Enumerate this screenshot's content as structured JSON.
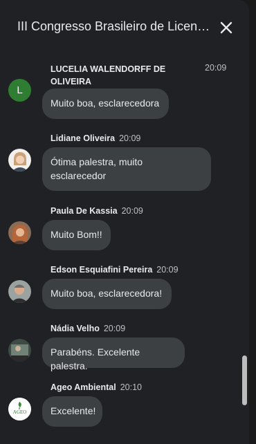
{
  "header": {
    "title": "III Congresso Brasileiro de Licenciaturas",
    "close_icon": "close-icon"
  },
  "messages": [
    {
      "author_line1": "LUCELIA WALENDORFF DE",
      "author_line2": "OLIVEIRA",
      "time": "20:09",
      "text": "Muito boa, esclarecedora",
      "avatar_letter": "L",
      "avatar_color": "#2e7d32"
    },
    {
      "author": "Lidiane Oliveira",
      "time": "20:09",
      "text_line1": "Ótima palestra, muito",
      "text_line2": "esclarecedor"
    },
    {
      "author": "Paula De Kassia",
      "time": "20:09",
      "text": "Muito Bom!!"
    },
    {
      "author": "Edson Esquiafini Pereira",
      "time": "20:09",
      "text": "Muito boa, esclarecedora!"
    },
    {
      "author": "Nádia Velho",
      "time": "20:09",
      "text": "Parabéns. Excelente palestra."
    },
    {
      "author": "Ageo Ambiental",
      "time": "20:10",
      "text": "Excelente!",
      "logo_text": "AGEO"
    }
  ]
}
